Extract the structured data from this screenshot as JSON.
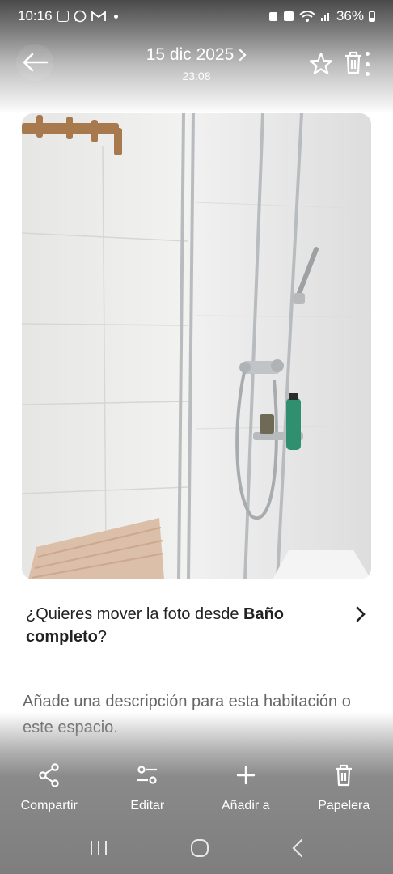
{
  "status_bar": {
    "time": "10:16",
    "battery": "36%"
  },
  "header": {
    "date": "15 dic 2025",
    "time": "23:08",
    "icons": [
      "back-arrow-icon",
      "star-icon",
      "trash-icon",
      "more-vert-icon"
    ]
  },
  "move_prompt": {
    "prefix": "¿Quieres mover la foto desde ",
    "room": "Baño completo",
    "suffix": "?"
  },
  "description": {
    "placeholder": "Añade una descripción para esta habitación o este espacio."
  },
  "actions": [
    {
      "label": "Compartir",
      "icon": "share-icon"
    },
    {
      "label": "Editar",
      "icon": "edit-sliders-icon"
    },
    {
      "label": "Añadir a",
      "icon": "plus-icon"
    },
    {
      "label": "Papelera",
      "icon": "trash-icon"
    }
  ],
  "colors": {
    "header_fg": "#ffffff",
    "text": "#222222",
    "muted": "#666666"
  }
}
